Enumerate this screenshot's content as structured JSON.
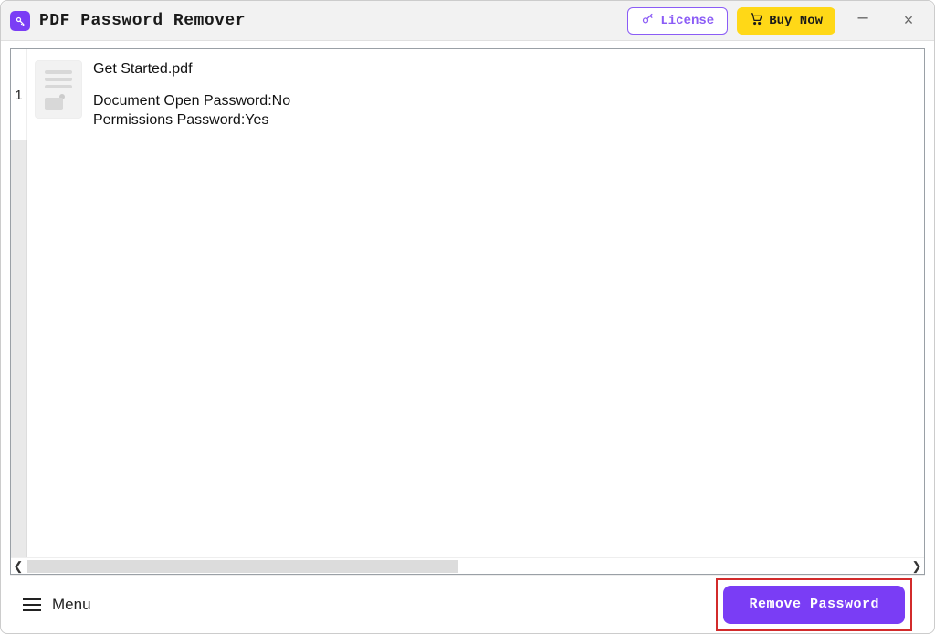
{
  "app": {
    "title": "PDF Password Remover"
  },
  "header": {
    "license_label": "License",
    "buy_label": "Buy Now"
  },
  "files": [
    {
      "index": "1",
      "name": "Get Started.pdf",
      "open_password_line": "Document Open Password:No",
      "permissions_password_line": "Permissions Password:Yes"
    }
  ],
  "footer": {
    "menu_label": "Menu",
    "remove_label": "Remove Password"
  },
  "colors": {
    "accent": "#7a3df5",
    "buy_bg": "#ffd817",
    "highlight_border": "#d22b2b"
  }
}
